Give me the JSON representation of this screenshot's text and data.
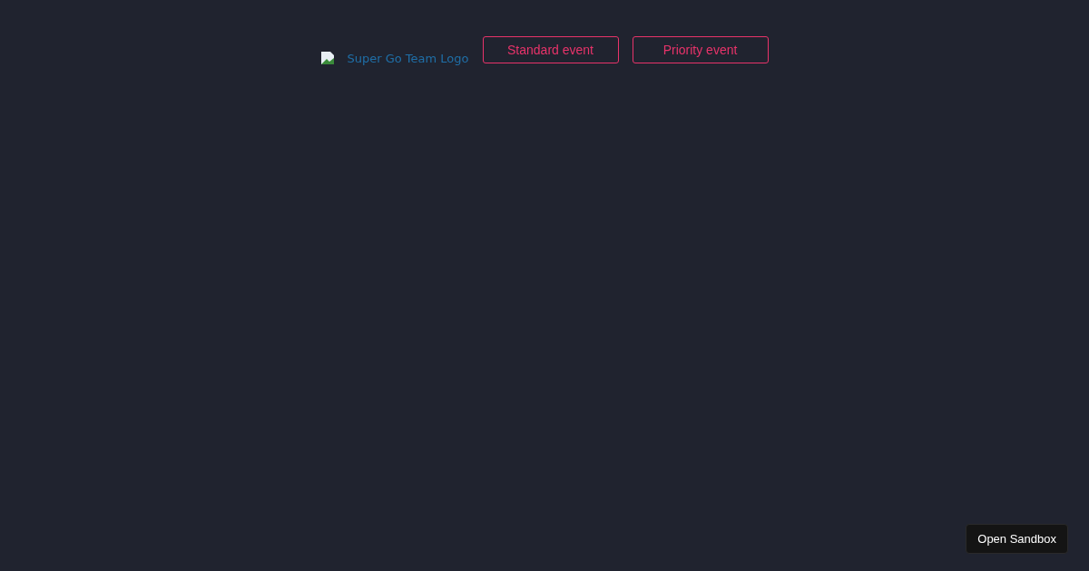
{
  "logo": {
    "alt": "Super Go Team Logo"
  },
  "buttons": [
    {
      "label": "Standard event"
    },
    {
      "label": "Priority event"
    }
  ],
  "sandbox_button": {
    "label": "Open Sandbox"
  }
}
